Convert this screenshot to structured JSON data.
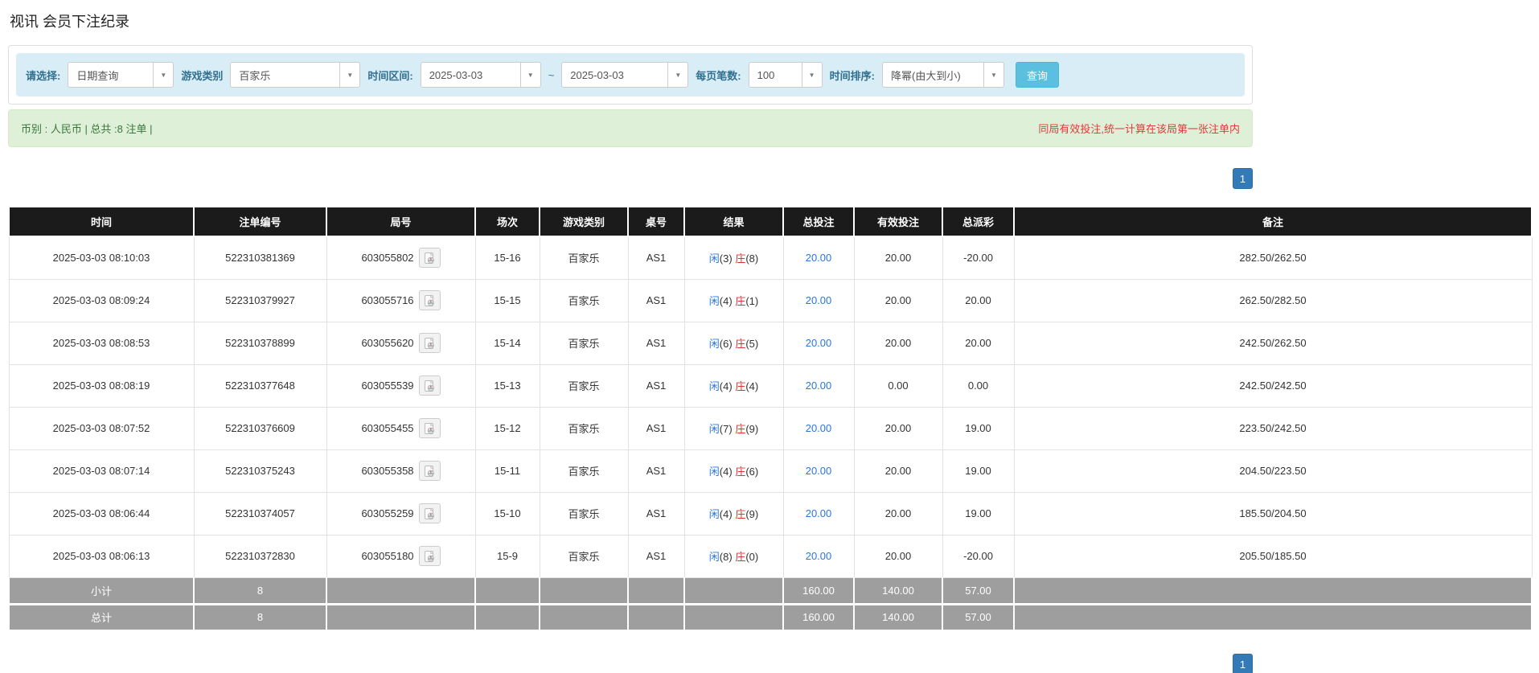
{
  "page": {
    "title": "视讯 会员下注纪录"
  },
  "filters": {
    "select_label": "请选择:",
    "select_value": "日期查询",
    "game_label": "游戏类别",
    "game_value": "百家乐",
    "range_label": "时间区间:",
    "date_from": "2025-03-03",
    "tilde": "~",
    "date_to": "2025-03-03",
    "page_size_label": "每页笔数:",
    "page_size_value": "100",
    "sort_label": "时间排序:",
    "sort_value": "降幂(由大到小)",
    "search_button": "查询"
  },
  "summary": {
    "left_text": "币别 : 人民币 | 总共 :8 注单 |",
    "right_notice": "同局有效投注,统一计算在该局第一张注单内"
  },
  "pagination": {
    "page": "1"
  },
  "colors": {
    "filter_bar_bg": "#d9edf7",
    "filter_label": "#31708f",
    "summary_bg": "#dff0d8",
    "summary_text": "#3c763d",
    "notice_red": "#e03a3a",
    "header_bg": "#1b1b1b",
    "footer_bg": "#9e9e9e",
    "link_blue": "#2a76dd",
    "negative_red": "#e43b3b",
    "search_button_bg": "#5bc0de",
    "page_button_bg": "#337ab7"
  },
  "table": {
    "headers": [
      "时间",
      "注单编号",
      "局号",
      "场次",
      "游戏类别",
      "桌号",
      "结果",
      "总投注",
      "有效投注",
      "总派彩",
      "备注"
    ],
    "rows": [
      {
        "time": "2025-03-03 08:10:03",
        "bet_id": "522310381369",
        "round_id": "603055802",
        "session": "15-16",
        "game": "百家乐",
        "table_no": "AS1",
        "xian": "闲",
        "xian_n": "(3)",
        "zhuang": "庄",
        "zhuang_n": "(8)",
        "total_bet": "20.00",
        "valid_bet": "20.00",
        "payout": "-20.00",
        "payout_neg": true,
        "remark": "282.50/262.50"
      },
      {
        "time": "2025-03-03 08:09:24",
        "bet_id": "522310379927",
        "round_id": "603055716",
        "session": "15-15",
        "game": "百家乐",
        "table_no": "AS1",
        "xian": "闲",
        "xian_n": "(4)",
        "zhuang": "庄",
        "zhuang_n": "(1)",
        "total_bet": "20.00",
        "valid_bet": "20.00",
        "payout": "20.00",
        "payout_neg": false,
        "remark": "262.50/282.50"
      },
      {
        "time": "2025-03-03 08:08:53",
        "bet_id": "522310378899",
        "round_id": "603055620",
        "session": "15-14",
        "game": "百家乐",
        "table_no": "AS1",
        "xian": "闲",
        "xian_n": "(6)",
        "zhuang": "庄",
        "zhuang_n": "(5)",
        "total_bet": "20.00",
        "valid_bet": "20.00",
        "payout": "20.00",
        "payout_neg": false,
        "remark": "242.50/262.50"
      },
      {
        "time": "2025-03-03 08:08:19",
        "bet_id": "522310377648",
        "round_id": "603055539",
        "session": "15-13",
        "game": "百家乐",
        "table_no": "AS1",
        "xian": "闲",
        "xian_n": "(4)",
        "zhuang": "庄",
        "zhuang_n": "(4)",
        "total_bet": "20.00",
        "valid_bet": "0.00",
        "payout": "0.00",
        "payout_neg": false,
        "remark": "242.50/242.50"
      },
      {
        "time": "2025-03-03 08:07:52",
        "bet_id": "522310376609",
        "round_id": "603055455",
        "session": "15-12",
        "game": "百家乐",
        "table_no": "AS1",
        "xian": "闲",
        "xian_n": "(7)",
        "zhuang": "庄",
        "zhuang_n": "(9)",
        "total_bet": "20.00",
        "valid_bet": "20.00",
        "payout": "19.00",
        "payout_neg": false,
        "remark": "223.50/242.50"
      },
      {
        "time": "2025-03-03 08:07:14",
        "bet_id": "522310375243",
        "round_id": "603055358",
        "session": "15-11",
        "game": "百家乐",
        "table_no": "AS1",
        "xian": "闲",
        "xian_n": "(4)",
        "zhuang": "庄",
        "zhuang_n": "(6)",
        "total_bet": "20.00",
        "valid_bet": "20.00",
        "payout": "19.00",
        "payout_neg": false,
        "remark": "204.50/223.50"
      },
      {
        "time": "2025-03-03 08:06:44",
        "bet_id": "522310374057",
        "round_id": "603055259",
        "session": "15-10",
        "game": "百家乐",
        "table_no": "AS1",
        "xian": "闲",
        "xian_n": "(4)",
        "zhuang": "庄",
        "zhuang_n": "(9)",
        "total_bet": "20.00",
        "valid_bet": "20.00",
        "payout": "19.00",
        "payout_neg": false,
        "remark": "185.50/204.50"
      },
      {
        "time": "2025-03-03 08:06:13",
        "bet_id": "522310372830",
        "round_id": "603055180",
        "session": "15-9",
        "game": "百家乐",
        "table_no": "AS1",
        "xian": "闲",
        "xian_n": "(8)",
        "zhuang": "庄",
        "zhuang_n": "(0)",
        "total_bet": "20.00",
        "valid_bet": "20.00",
        "payout": "-20.00",
        "payout_neg": true,
        "remark": "205.50/185.50"
      }
    ],
    "subtotal": {
      "label": "小计",
      "count": "8",
      "total_bet": "160.00",
      "valid_bet": "140.00",
      "payout": "57.00"
    },
    "total": {
      "label": "总计",
      "count": "8",
      "total_bet": "160.00",
      "valid_bet": "140.00",
      "payout": "57.00"
    }
  }
}
